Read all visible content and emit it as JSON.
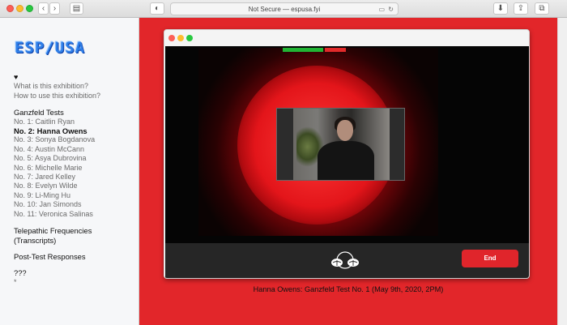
{
  "browser": {
    "address": "Not Secure — espusa.fyi"
  },
  "sidebar": {
    "logo": "ESP/USA",
    "heart": "♥",
    "links": [
      "What is this exhibition?",
      "How to use this exhibition?"
    ],
    "ganzfeld_heading": "Ganzfeld Tests",
    "tests": [
      "No. 1: Caitlin Ryan",
      "No. 2: Hanna Owens",
      "No. 3: Sonya Bogdanova",
      "No. 4: Austin McCann",
      "No. 5: Asya Dubrovina",
      "No. 6: Michelle Marie",
      "No. 7: Jared Kelley",
      "No. 8: Evelyn Wilde",
      "No. 9: Li-Ming Hu",
      "No. 10: Jan Simonds",
      "No. 11: Veronica Salinas"
    ],
    "active_index": 1,
    "telepathic": "Telepathic Frequencies (Transcripts)",
    "post_test": "Post-Test Responses",
    "mystery": "???",
    "asterisk": "*"
  },
  "video": {
    "end_label": "End",
    "caption": "Hanna Owens: Ganzfeld Test No. 1 (May 9th, 2020, 2PM)"
  },
  "colors": {
    "content_bg": "#e2262a",
    "logo": "#2f7fe8",
    "end_button": "#e0252b"
  }
}
